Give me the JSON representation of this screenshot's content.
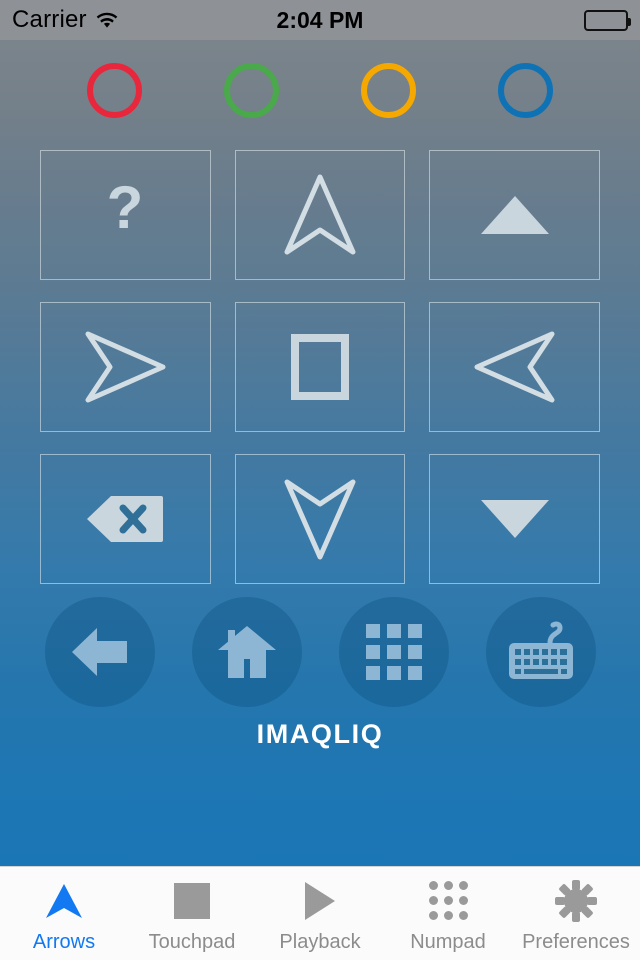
{
  "status_bar": {
    "carrier": "Carrier",
    "wifi_icon": "wifi-icon",
    "time": "2:04 PM",
    "battery_icon": "battery-full-icon"
  },
  "rings": [
    {
      "name": "red",
      "color": "#e8273c"
    },
    {
      "name": "green",
      "color": "#4aa94a"
    },
    {
      "name": "orange",
      "color": "#f5a800"
    },
    {
      "name": "blue",
      "color": "#0f72b5"
    }
  ],
  "arrow_grid": [
    {
      "name": "help",
      "icon": "question-mark-icon"
    },
    {
      "name": "up",
      "icon": "arrow-up-outline-icon"
    },
    {
      "name": "page-up",
      "icon": "triangle-up-filled-icon"
    },
    {
      "name": "left",
      "icon": "arrow-left-outline-icon"
    },
    {
      "name": "select",
      "icon": "square-outline-icon"
    },
    {
      "name": "right",
      "icon": "arrow-right-outline-icon"
    },
    {
      "name": "backspace",
      "icon": "backspace-icon"
    },
    {
      "name": "down",
      "icon": "arrow-down-outline-icon"
    },
    {
      "name": "page-down",
      "icon": "triangle-down-filled-icon"
    }
  ],
  "circle_buttons": [
    {
      "name": "back",
      "icon": "arrow-left-filled-icon"
    },
    {
      "name": "home",
      "icon": "home-icon"
    },
    {
      "name": "apps",
      "icon": "grid-apps-icon"
    },
    {
      "name": "keyboard",
      "icon": "keyboard-icon"
    }
  ],
  "brand": {
    "title": "IMAQLIQ"
  },
  "tabs": [
    {
      "label": "Arrows",
      "icon": "navigation-arrow-icon",
      "active": true
    },
    {
      "label": "Touchpad",
      "icon": "square-filled-icon",
      "active": false
    },
    {
      "label": "Playback",
      "icon": "play-triangle-icon",
      "active": false
    },
    {
      "label": "Numpad",
      "icon": "nine-dots-icon",
      "active": false
    },
    {
      "label": "Preferences",
      "icon": "gear-icon",
      "active": false
    }
  ],
  "colors": {
    "accent": "#1279f2",
    "inactive": "#8c8c8c",
    "panel_top": "#7b848b",
    "panel_bottom": "#1b76b6",
    "icon_light": "#c9d6de"
  }
}
